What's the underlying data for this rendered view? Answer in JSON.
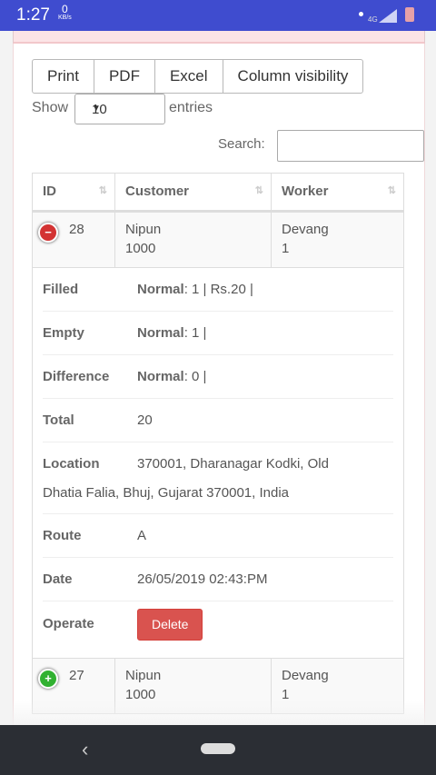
{
  "status_bar": {
    "time": "1:27",
    "net_speed": "0",
    "net_unit": "KB/s",
    "network": "4G"
  },
  "toolbar": {
    "buttons": [
      "Print",
      "PDF",
      "Excel",
      "Column visibility"
    ]
  },
  "length": {
    "show_label": "Show",
    "value": "10",
    "entries_label": "entries"
  },
  "search": {
    "label": "Search:",
    "value": ""
  },
  "table": {
    "columns": [
      "ID",
      "Customer",
      "Worker"
    ],
    "rows": [
      {
        "id": "28",
        "customer_name": "Nipun",
        "customer_no": "1000",
        "worker_name": "Devang",
        "worker_no": "1",
        "expanded": true
      },
      {
        "id": "27",
        "customer_name": "Nipun",
        "customer_no": "1000",
        "worker_name": "Devang",
        "worker_no": "1",
        "expanded": false
      }
    ],
    "details": {
      "filled": {
        "label": "Filled",
        "type": "Normal",
        "value": ": 1 | Rs.20 |"
      },
      "empty": {
        "label": "Empty",
        "type": "Normal",
        "value": ": 1 |"
      },
      "difference": {
        "label": "Difference",
        "type": "Normal",
        "value": ": 0 |"
      },
      "total": {
        "label": "Total",
        "value": "20"
      },
      "location": {
        "label": "Location",
        "value_line1": "370001, Dharanagar Kodki, Old",
        "value_line2": "Dhatia Falia, Bhuj, Gujarat 370001, India"
      },
      "route": {
        "label": "Route",
        "value": "A"
      },
      "date": {
        "label": "Date",
        "value": "26/05/2019 02:43:PM"
      },
      "operate": {
        "label": "Operate",
        "delete_label": "Delete"
      }
    }
  },
  "colors": {
    "status_bar": "#3f4ccf",
    "delete": "#d9534f",
    "collapse_control": "#d33333",
    "expand_control": "#31b131",
    "nav_bar": "#2b2e34"
  },
  "icons": {
    "collapse": "minus-circle-icon",
    "expand": "plus-circle-icon",
    "sort": "sort-icon",
    "back": "back-chevron-icon"
  }
}
